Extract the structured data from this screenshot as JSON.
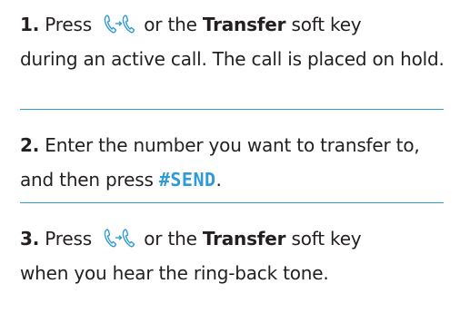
{
  "steps": [
    {
      "number": "1.",
      "pre": " Press ",
      "mid": " or the ",
      "softkey": "Transfer",
      "post_line1": " soft key",
      "post": "during an active call. The call is placed on hold.",
      "icon": "transfer-icon"
    },
    {
      "number": "2.",
      "pre": " Enter the number you want to transfer to, and then press ",
      "key": "#SEND",
      "post": "."
    },
    {
      "number": "3.",
      "pre": " Press ",
      "mid": " or the ",
      "softkey": "Transfer",
      "post_line1": " soft key",
      "post": "when you hear the ring-back tone.",
      "icon": "transfer-icon"
    }
  ],
  "colors": {
    "accent": "#2f9ad6",
    "text": "#231f20"
  }
}
